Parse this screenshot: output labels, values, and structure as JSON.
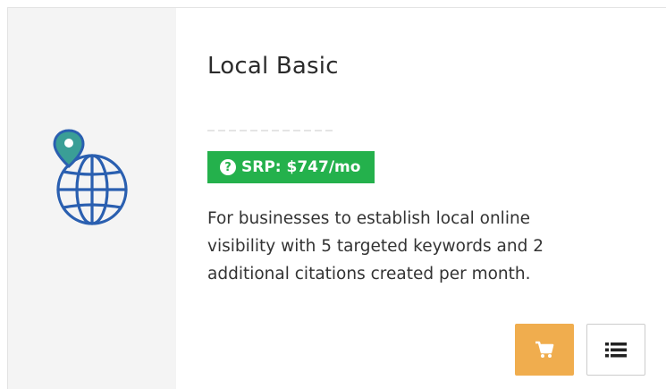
{
  "plan": {
    "title": "Local Basic",
    "srp_label": "SRP: $747/mo",
    "description": "For businesses to establish local online visibility with 5 targeted keywords and 2 additional citations created per month."
  },
  "icons": {
    "plan_icon": "globe-with-map-pin-icon",
    "srp_info": "question-circle-icon",
    "cart": "shopping-cart-icon",
    "details": "list-icon"
  },
  "colors": {
    "badge": "#24b14c",
    "cart_button": "#f0ad4e",
    "globe": "#2a5fb0",
    "pin": "#3a9e96",
    "icon_panel": "#f4f4f4"
  }
}
